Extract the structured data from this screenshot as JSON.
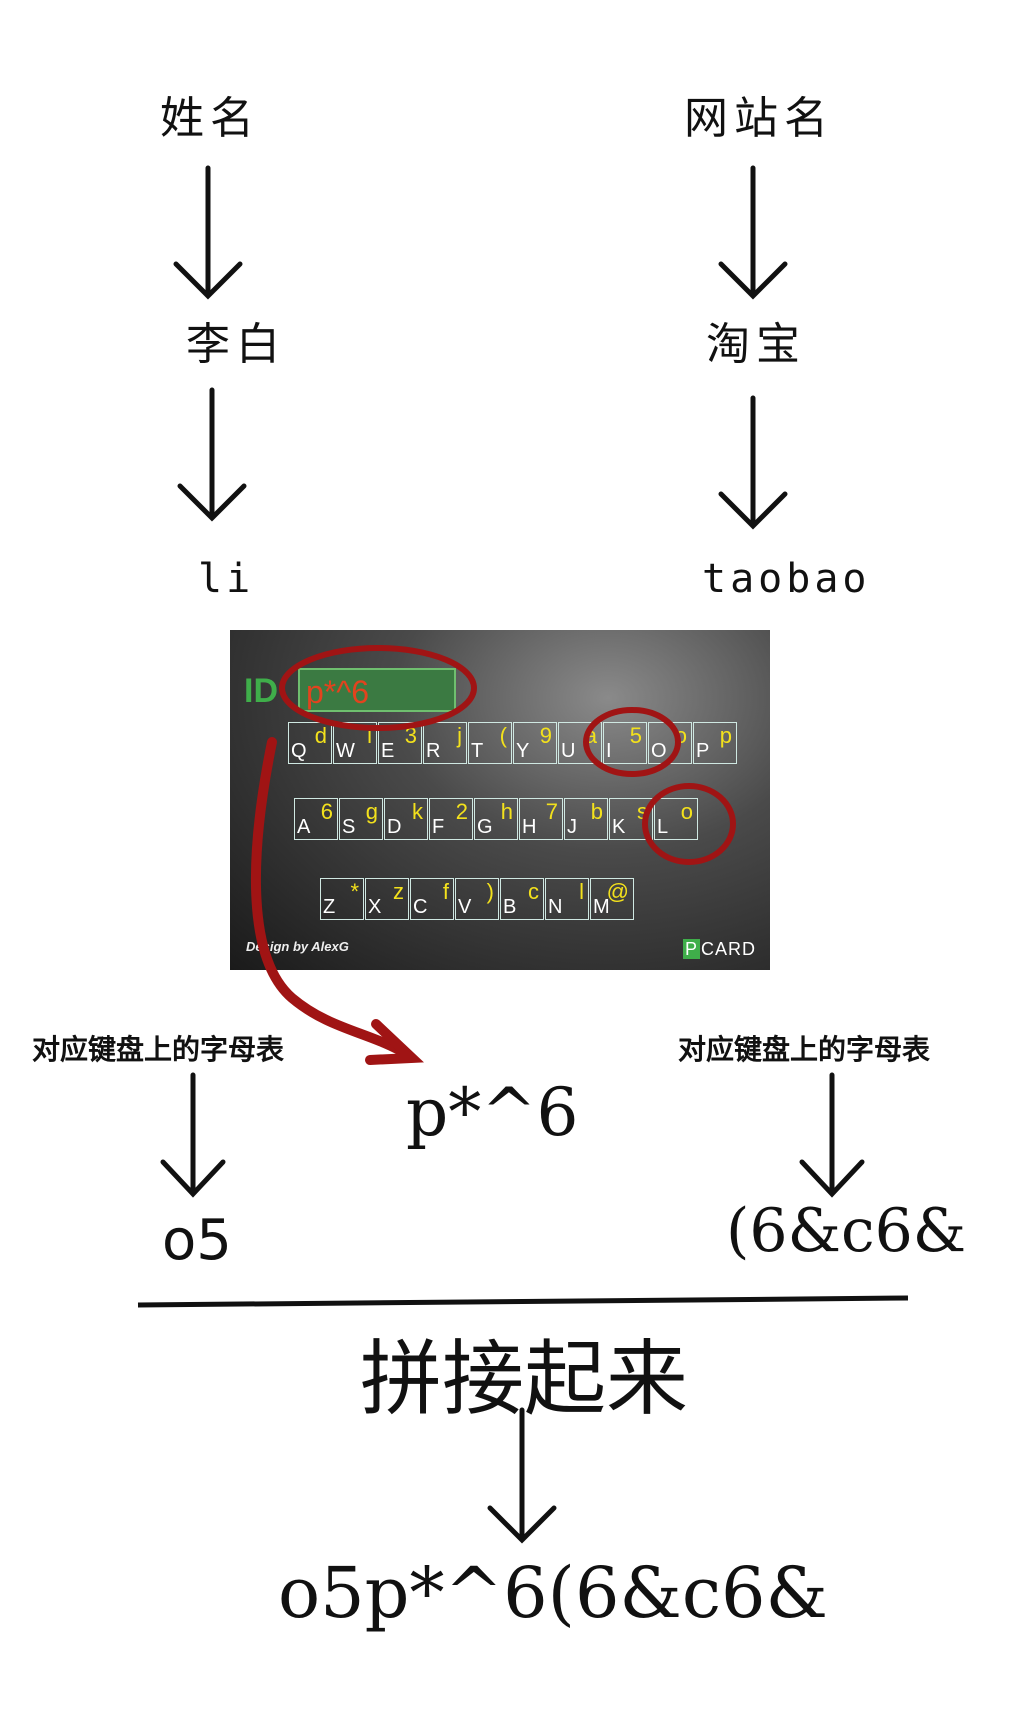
{
  "left_column": {
    "heading": "姓名",
    "example": "李白",
    "pinyin": "li",
    "caption": "对应键盘上的字母表",
    "result": "o5"
  },
  "right_column": {
    "heading": "网站名",
    "example": "淘宝",
    "pinyin": "taobao",
    "caption": "对应键盘上的字母表",
    "result": "(6&c6&"
  },
  "card": {
    "id_label": "ID",
    "field_value": "p*^6",
    "credit": "Design by AlexG",
    "brand_rest": "CARD",
    "brand_mark": "P",
    "rows": [
      [
        {
          "l": "Q",
          "r": "d"
        },
        {
          "l": "W",
          "r": "i"
        },
        {
          "l": "E",
          "r": "3"
        },
        {
          "l": "R",
          "r": "j"
        },
        {
          "l": "T",
          "r": "("
        },
        {
          "l": "Y",
          "r": "9"
        },
        {
          "l": "U",
          "r": "a"
        },
        {
          "l": "I",
          "r": "5"
        },
        {
          "l": "O",
          "r": "o"
        },
        {
          "l": "P",
          "r": "p"
        }
      ],
      [
        {
          "l": "A",
          "r": "6"
        },
        {
          "l": "S",
          "r": "g"
        },
        {
          "l": "D",
          "r": "k"
        },
        {
          "l": "F",
          "r": "2"
        },
        {
          "l": "G",
          "r": "h"
        },
        {
          "l": "H",
          "r": "7"
        },
        {
          "l": "J",
          "r": "b"
        },
        {
          "l": "K",
          "r": "s"
        },
        {
          "l": "L",
          "r": "o"
        }
      ],
      [
        {
          "l": "Z",
          "r": "*"
        },
        {
          "l": "X",
          "r": "z"
        },
        {
          "l": "C",
          "r": "f"
        },
        {
          "l": "V",
          "r": ")"
        },
        {
          "l": "B",
          "r": "c"
        },
        {
          "l": "N",
          "r": "l"
        },
        {
          "l": "M",
          "r": "@"
        }
      ]
    ]
  },
  "middle_value": "p*^6",
  "join_label": "拼接起来",
  "final_result": "o5p*^6(6&c6&",
  "colors": {
    "annotation": "#a01414",
    "key_upper": "#ffffff",
    "key_lower": "#f3e11c",
    "field_bg": "#3b7a42",
    "field_text": "#e2431e"
  }
}
